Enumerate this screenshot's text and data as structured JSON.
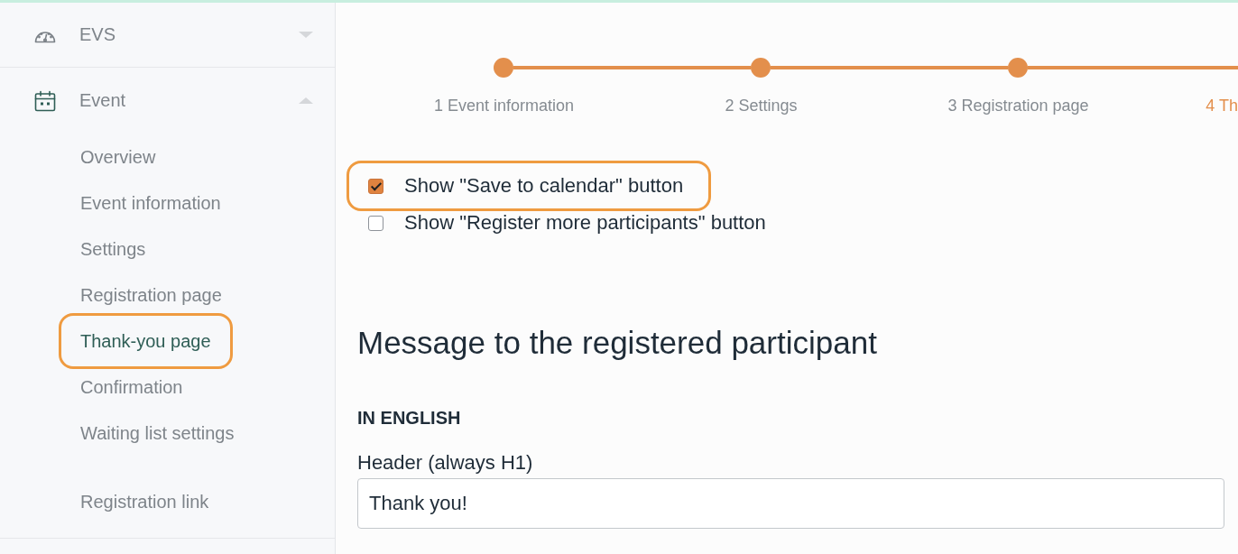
{
  "sidebar": {
    "sections": [
      {
        "label": "EVS",
        "expanded": false
      },
      {
        "label": "Event",
        "expanded": true,
        "children": [
          {
            "label": "Overview",
            "selected": false,
            "highlighted": false
          },
          {
            "label": "Event information",
            "selected": false,
            "highlighted": false
          },
          {
            "label": "Settings",
            "selected": false,
            "highlighted": false
          },
          {
            "label": "Registration page",
            "selected": false,
            "highlighted": false
          },
          {
            "label": "Thank-you page",
            "selected": true,
            "highlighted": true
          },
          {
            "label": "Confirmation",
            "selected": false,
            "highlighted": false
          },
          {
            "label": "Waiting list settings",
            "selected": false,
            "highlighted": false
          }
        ],
        "footer_items": [
          {
            "label": "Registration link",
            "selected": false
          }
        ]
      }
    ]
  },
  "stepper": {
    "steps": [
      {
        "label": "1 Event information",
        "selected": false
      },
      {
        "label": "2 Settings",
        "selected": false
      },
      {
        "label": "3 Registration page",
        "selected": false
      },
      {
        "label": "4 Th",
        "selected": true
      }
    ]
  },
  "options": [
    {
      "label": "Show \"Save to calendar\" button",
      "checked": true,
      "highlighted": true
    },
    {
      "label": "Show \"Register more participants\" button",
      "checked": false,
      "highlighted": false
    }
  ],
  "message": {
    "heading": "Message to the registered participant",
    "language_heading": "IN ENGLISH",
    "fields": [
      {
        "label": "Header (always H1)",
        "value": "Thank you!"
      }
    ]
  }
}
